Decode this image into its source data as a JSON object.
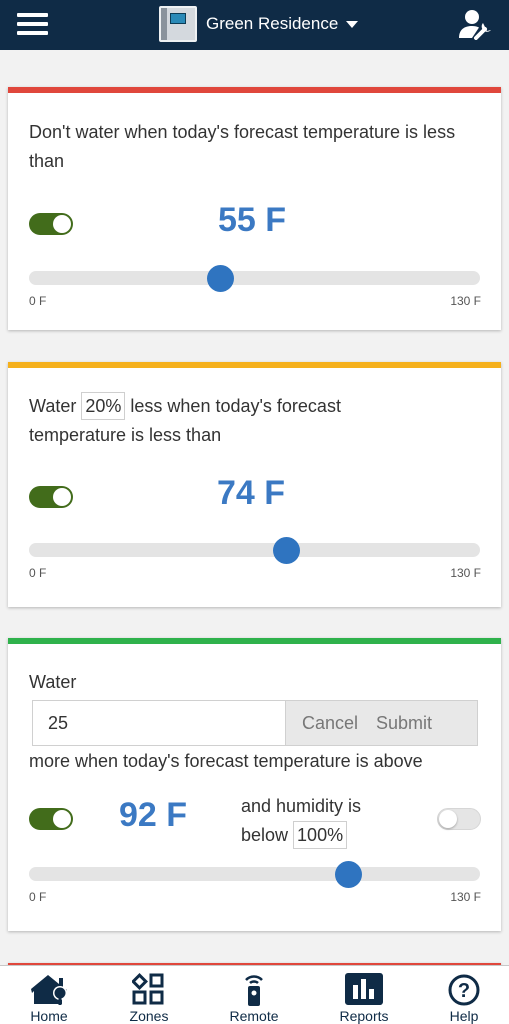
{
  "header": {
    "controller_name": "Green Residence"
  },
  "colors": {
    "header_bg": "#0f2b46",
    "accent_blue": "#3b79c3",
    "toggle_on": "#426c1b",
    "stripe_red": "#e0473c",
    "stripe_yellow": "#f5b01b",
    "stripe_green": "#2fb24c"
  },
  "cards": [
    {
      "text": "Don't water when today's forecast temperature is less than",
      "toggle_on": true,
      "value_label": "55 F",
      "value": 55,
      "range_min": 0,
      "range_max": 130,
      "min_label": "0 F",
      "max_label": "130 F"
    },
    {
      "text_before": "Water",
      "percent": "20%",
      "text_after": "less when today's forecast",
      "text_line2": "temperature is less than",
      "toggle_on": true,
      "value_label": "74 F",
      "value": 74,
      "range_min": 0,
      "range_max": 130,
      "min_label": "0 F",
      "max_label": "130 F"
    },
    {
      "text_before": "Water",
      "input_value": "25",
      "cancel_label": "Cancel",
      "submit_label": "Submit",
      "text_after": "more when today's forecast temperature is above",
      "toggle_on": true,
      "value_label": "92 F",
      "value": 92,
      "humidity_text_1": "and humidity is",
      "humidity_text_2": "below",
      "humidity_value": "100%",
      "humidity_toggle_on": false,
      "range_min": 0,
      "range_max": 130,
      "min_label": "0 F",
      "max_label": "130 F"
    }
  ],
  "nav": [
    {
      "label": "Home",
      "icon": "home-icon"
    },
    {
      "label": "Zones",
      "icon": "zones-icon"
    },
    {
      "label": "Remote",
      "icon": "remote-icon"
    },
    {
      "label": "Reports",
      "icon": "reports-icon"
    },
    {
      "label": "Help",
      "icon": "help-icon"
    }
  ]
}
